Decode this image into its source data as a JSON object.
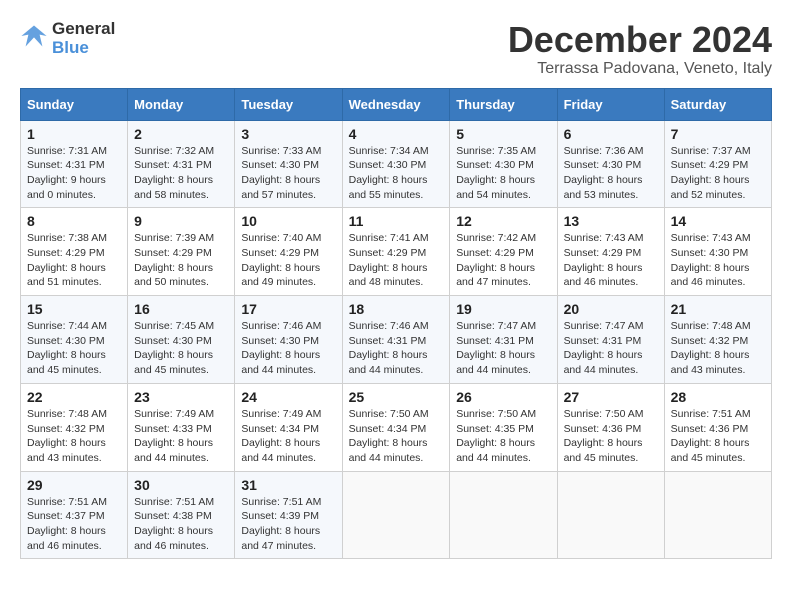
{
  "logo": {
    "line1": "General",
    "line2": "Blue"
  },
  "title": "December 2024",
  "location": "Terrassa Padovana, Veneto, Italy",
  "days_of_week": [
    "Sunday",
    "Monday",
    "Tuesday",
    "Wednesday",
    "Thursday",
    "Friday",
    "Saturday"
  ],
  "weeks": [
    [
      {
        "day": "1",
        "info": "Sunrise: 7:31 AM\nSunset: 4:31 PM\nDaylight: 9 hours\nand 0 minutes."
      },
      {
        "day": "2",
        "info": "Sunrise: 7:32 AM\nSunset: 4:31 PM\nDaylight: 8 hours\nand 58 minutes."
      },
      {
        "day": "3",
        "info": "Sunrise: 7:33 AM\nSunset: 4:30 PM\nDaylight: 8 hours\nand 57 minutes."
      },
      {
        "day": "4",
        "info": "Sunrise: 7:34 AM\nSunset: 4:30 PM\nDaylight: 8 hours\nand 55 minutes."
      },
      {
        "day": "5",
        "info": "Sunrise: 7:35 AM\nSunset: 4:30 PM\nDaylight: 8 hours\nand 54 minutes."
      },
      {
        "day": "6",
        "info": "Sunrise: 7:36 AM\nSunset: 4:30 PM\nDaylight: 8 hours\nand 53 minutes."
      },
      {
        "day": "7",
        "info": "Sunrise: 7:37 AM\nSunset: 4:29 PM\nDaylight: 8 hours\nand 52 minutes."
      }
    ],
    [
      {
        "day": "8",
        "info": "Sunrise: 7:38 AM\nSunset: 4:29 PM\nDaylight: 8 hours\nand 51 minutes."
      },
      {
        "day": "9",
        "info": "Sunrise: 7:39 AM\nSunset: 4:29 PM\nDaylight: 8 hours\nand 50 minutes."
      },
      {
        "day": "10",
        "info": "Sunrise: 7:40 AM\nSunset: 4:29 PM\nDaylight: 8 hours\nand 49 minutes."
      },
      {
        "day": "11",
        "info": "Sunrise: 7:41 AM\nSunset: 4:29 PM\nDaylight: 8 hours\nand 48 minutes."
      },
      {
        "day": "12",
        "info": "Sunrise: 7:42 AM\nSunset: 4:29 PM\nDaylight: 8 hours\nand 47 minutes."
      },
      {
        "day": "13",
        "info": "Sunrise: 7:43 AM\nSunset: 4:29 PM\nDaylight: 8 hours\nand 46 minutes."
      },
      {
        "day": "14",
        "info": "Sunrise: 7:43 AM\nSunset: 4:30 PM\nDaylight: 8 hours\nand 46 minutes."
      }
    ],
    [
      {
        "day": "15",
        "info": "Sunrise: 7:44 AM\nSunset: 4:30 PM\nDaylight: 8 hours\nand 45 minutes."
      },
      {
        "day": "16",
        "info": "Sunrise: 7:45 AM\nSunset: 4:30 PM\nDaylight: 8 hours\nand 45 minutes."
      },
      {
        "day": "17",
        "info": "Sunrise: 7:46 AM\nSunset: 4:30 PM\nDaylight: 8 hours\nand 44 minutes."
      },
      {
        "day": "18",
        "info": "Sunrise: 7:46 AM\nSunset: 4:31 PM\nDaylight: 8 hours\nand 44 minutes."
      },
      {
        "day": "19",
        "info": "Sunrise: 7:47 AM\nSunset: 4:31 PM\nDaylight: 8 hours\nand 44 minutes."
      },
      {
        "day": "20",
        "info": "Sunrise: 7:47 AM\nSunset: 4:31 PM\nDaylight: 8 hours\nand 44 minutes."
      },
      {
        "day": "21",
        "info": "Sunrise: 7:48 AM\nSunset: 4:32 PM\nDaylight: 8 hours\nand 43 minutes."
      }
    ],
    [
      {
        "day": "22",
        "info": "Sunrise: 7:48 AM\nSunset: 4:32 PM\nDaylight: 8 hours\nand 43 minutes."
      },
      {
        "day": "23",
        "info": "Sunrise: 7:49 AM\nSunset: 4:33 PM\nDaylight: 8 hours\nand 44 minutes."
      },
      {
        "day": "24",
        "info": "Sunrise: 7:49 AM\nSunset: 4:34 PM\nDaylight: 8 hours\nand 44 minutes."
      },
      {
        "day": "25",
        "info": "Sunrise: 7:50 AM\nSunset: 4:34 PM\nDaylight: 8 hours\nand 44 minutes."
      },
      {
        "day": "26",
        "info": "Sunrise: 7:50 AM\nSunset: 4:35 PM\nDaylight: 8 hours\nand 44 minutes."
      },
      {
        "day": "27",
        "info": "Sunrise: 7:50 AM\nSunset: 4:36 PM\nDaylight: 8 hours\nand 45 minutes."
      },
      {
        "day": "28",
        "info": "Sunrise: 7:51 AM\nSunset: 4:36 PM\nDaylight: 8 hours\nand 45 minutes."
      }
    ],
    [
      {
        "day": "29",
        "info": "Sunrise: 7:51 AM\nSunset: 4:37 PM\nDaylight: 8 hours\nand 46 minutes."
      },
      {
        "day": "30",
        "info": "Sunrise: 7:51 AM\nSunset: 4:38 PM\nDaylight: 8 hours\nand 46 minutes."
      },
      {
        "day": "31",
        "info": "Sunrise: 7:51 AM\nSunset: 4:39 PM\nDaylight: 8 hours\nand 47 minutes."
      },
      {
        "day": "",
        "info": ""
      },
      {
        "day": "",
        "info": ""
      },
      {
        "day": "",
        "info": ""
      },
      {
        "day": "",
        "info": ""
      }
    ]
  ]
}
